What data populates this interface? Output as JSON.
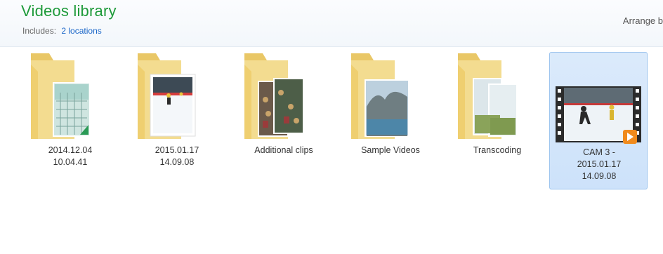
{
  "header": {
    "title": "Videos library",
    "includes_label": "Includes:",
    "locations_link": "2 locations",
    "arrange_label": "Arrange b"
  },
  "items": [
    {
      "label": "2014.12.04\n10.04.41",
      "icon": "folder-icon",
      "thumbnail": "fence-photo"
    },
    {
      "label": "2015.01.17\n14.09.08",
      "icon": "folder-icon",
      "thumbnail": "hockey-rink-photo"
    },
    {
      "label": "Additional clips",
      "icon": "folder-icon",
      "thumbnail": "crowd-photo"
    },
    {
      "label": "Sample Videos",
      "icon": "folder-icon",
      "thumbnail": "landscape-photo"
    },
    {
      "label": "Transcoding",
      "icon": "folder-icon",
      "thumbnail": "snow-photo"
    },
    {
      "label": "CAM 3 -\n2015.01.17\n14.09.08",
      "icon": "video-file-icon",
      "thumbnail": "hockey-video-frame",
      "selected": true
    }
  ],
  "colors": {
    "title_green": "#1e9a3a",
    "link_blue": "#1a66c8",
    "folder_yellow": "#f1d98a",
    "selection_blue": "#cde2fa"
  }
}
